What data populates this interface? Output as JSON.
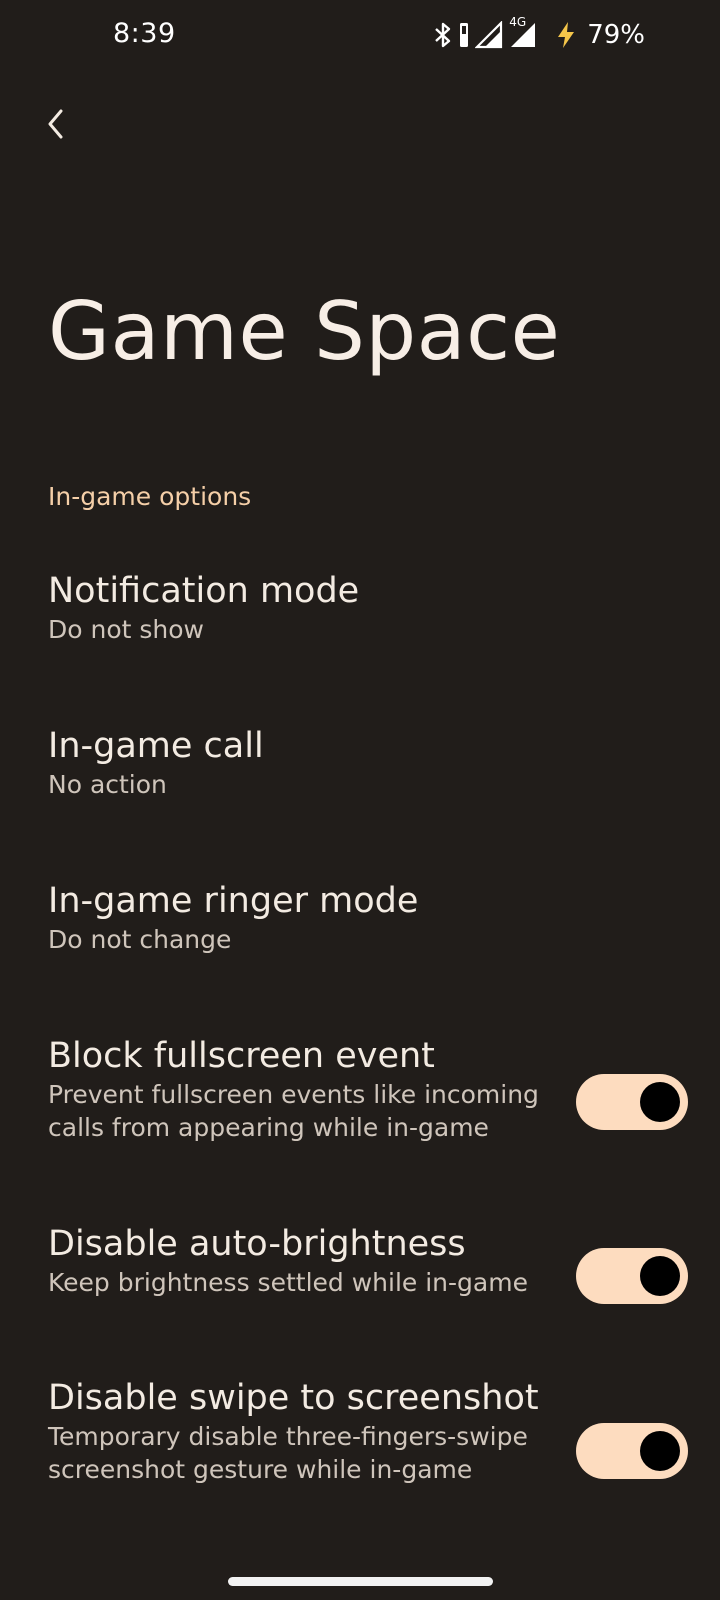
{
  "status_bar": {
    "time": "8:39",
    "network_label": "4G",
    "battery_percent": "79%",
    "icons": [
      "bluetooth-icon",
      "vibrate-icon",
      "wifi-signal-icon",
      "mobile-signal-icon",
      "charging-bolt-icon"
    ]
  },
  "header": {
    "back_icon": "chevron-left-icon",
    "title": "Game Space"
  },
  "section": {
    "label": "In-game options"
  },
  "preferences": [
    {
      "title": "Notification mode",
      "summary": "Do not show"
    },
    {
      "title": "In-game call",
      "summary": "No action"
    },
    {
      "title": "In-game ringer mode",
      "summary": "Do not change"
    },
    {
      "title": "Block fullscreen event",
      "summary": "Prevent fullscreen events like incoming calls from appearing while in-game",
      "toggle": true
    },
    {
      "title": "Disable auto-brightness",
      "summary": "Keep brightness settled while in-game",
      "toggle": true
    },
    {
      "title": "Disable swipe to screenshot",
      "summary": "Temporary disable three-fingers-swipe screenshot gesture while in-game",
      "toggle": true
    }
  ],
  "colors": {
    "background": "#211d1a",
    "accent": "#f5cfa8",
    "toggle_track": "#fddcbf",
    "toggle_knob": "#000000"
  }
}
